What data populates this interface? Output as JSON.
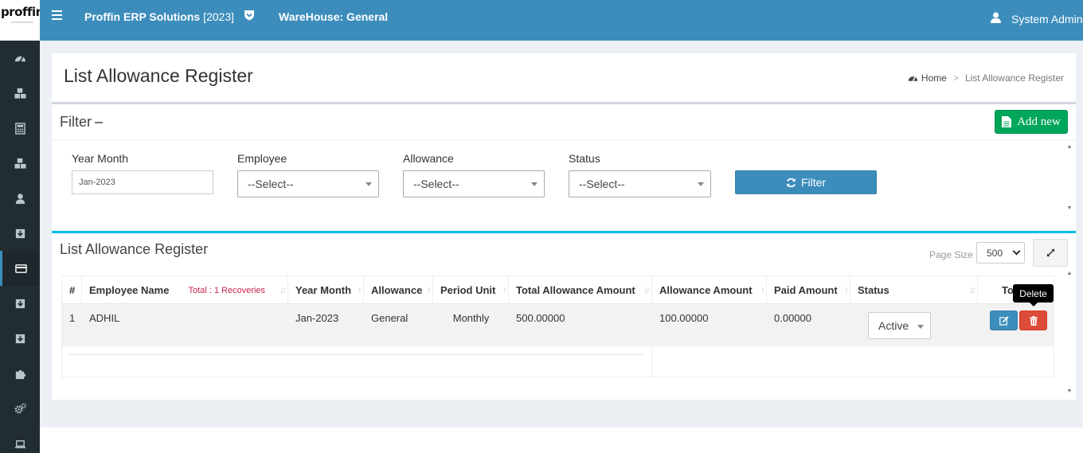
{
  "header": {
    "logo_text": "proffin",
    "app_name": "Proffin ERP Solutions",
    "app_year": "[2023]",
    "warehouse": "WareHouse: General",
    "user": "System Admin"
  },
  "sidebar": {
    "items": [
      {
        "icon": "dashboard-icon"
      },
      {
        "icon": "cubes-icon"
      },
      {
        "icon": "calculator-icon"
      },
      {
        "icon": "cubes-icon"
      },
      {
        "icon": "user-icon"
      },
      {
        "icon": "download-icon"
      },
      {
        "icon": "credit-card-icon",
        "active": true
      },
      {
        "icon": "download-icon"
      },
      {
        "icon": "download-icon"
      },
      {
        "icon": "puzzle-icon"
      },
      {
        "icon": "cogs-icon"
      },
      {
        "icon": "laptop-icon"
      }
    ]
  },
  "page": {
    "title": "List Allowance Register",
    "breadcrumb": {
      "home": "Home",
      "current": "List Allowance Register"
    }
  },
  "filter": {
    "title": "Filter",
    "add_new": "Add new",
    "year_month_label": "Year Month",
    "year_month_value": "Jan-2023",
    "employee_label": "Employee",
    "employee_value": "--Select--",
    "allowance_label": "Allowance",
    "allowance_value": "--Select--",
    "status_label": "Status",
    "status_value": "--Select--",
    "filter_button": "Filter"
  },
  "list": {
    "title": "List Allowance Register",
    "page_size_label": "Page Size",
    "page_size_value": "500",
    "columns": {
      "num": "#",
      "employee": "Employee Name",
      "total_note": "Total : 1 Recoveries",
      "year_month": "Year Month",
      "allowance": "Allowance",
      "period_unit": "Period Unit",
      "total_amount": "Total Allowance Amount",
      "allowance_amount": "Allowance Amount",
      "paid_amount": "Paid Amount",
      "status": "Status",
      "tools": "To"
    },
    "rows": [
      {
        "num": "1",
        "employee": "ADHIL",
        "year_month": "Jan-2023",
        "allowance": "General",
        "period_unit": "Monthly",
        "total_amount": "500.00000",
        "allowance_amount": "100.00000",
        "paid_amount": "0.00000",
        "status": "Active"
      }
    ],
    "tooltip": "Delete"
  },
  "colors": {
    "header": "#3c8dbc",
    "sidebar": "#222d32",
    "success": "#00a65a",
    "danger": "#dd4b39",
    "info_border": "#00c0ef"
  }
}
